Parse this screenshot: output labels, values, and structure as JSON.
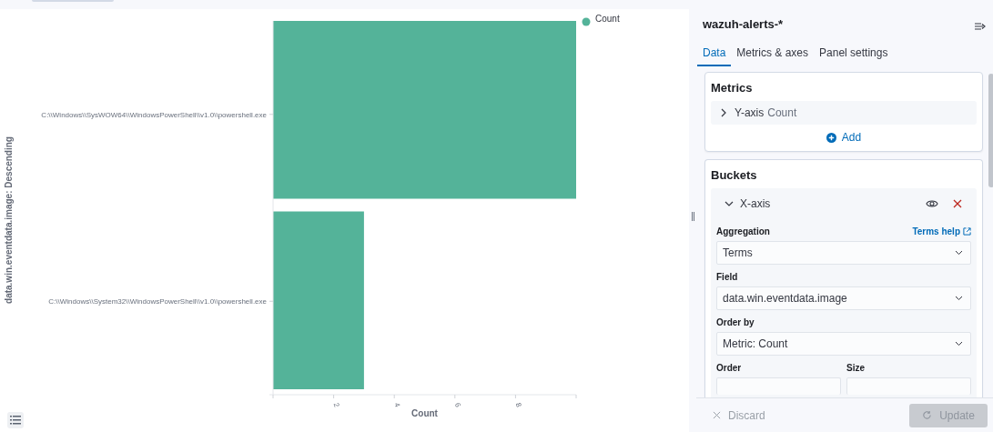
{
  "chart": {
    "chart_data": {
      "type": "bar",
      "orientation": "horizontal",
      "xlabel": "Count",
      "ylabel": "data.win.eventdata.image: Descending",
      "categories": [
        "C:\\\\Windows\\\\SysWOW64\\\\WindowsPowerShell\\\\v1.0\\\\powershell.exe",
        "C:\\\\Windows\\\\System32\\\\WindowsPowerShell\\\\v1.0\\\\powershell.exe"
      ],
      "series": [
        {
          "name": "Count",
          "color": "#54b399",
          "values": [
            10,
            3
          ]
        }
      ],
      "xlim": [
        0,
        10
      ],
      "xticks": [
        2,
        4,
        6,
        8
      ]
    }
  },
  "panel": {
    "title": "wazuh-alerts-*",
    "tabs": [
      {
        "label": "Data",
        "selected": true
      },
      {
        "label": "Metrics & axes",
        "selected": false
      },
      {
        "label": "Panel settings",
        "selected": false
      }
    ],
    "metrics": {
      "heading": "Metrics",
      "item": {
        "label": "Y-axis",
        "value": "Count",
        "expanded": false
      },
      "add": "Add"
    },
    "buckets": {
      "heading": "Buckets",
      "item": {
        "label": "X-axis",
        "expanded": true
      },
      "aggregation": {
        "label": "Aggregation",
        "help": "Terms help",
        "value": "Terms"
      },
      "field": {
        "label": "Field",
        "value": "data.win.eventdata.image"
      },
      "order_by": {
        "label": "Order by",
        "value": "Metric: Count"
      },
      "order": {
        "label": "Order"
      },
      "size": {
        "label": "Size"
      }
    },
    "discard": "Discard",
    "update": {
      "label": "Update",
      "disabled": true
    }
  }
}
